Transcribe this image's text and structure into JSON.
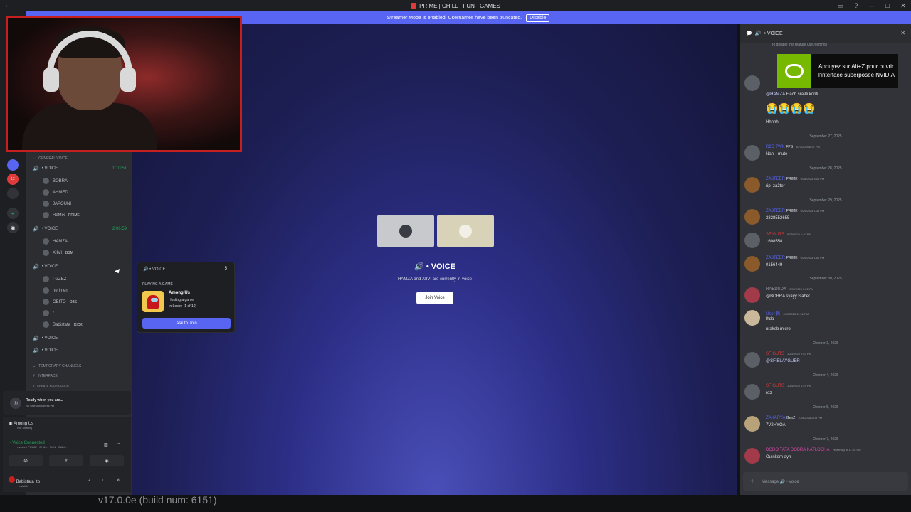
{
  "window": {
    "title": "PRIME | CHILL · FUN · GAMES"
  },
  "banner": {
    "text": "Streamer Mode is enabled. Usernames have been truncated.",
    "disable_label": "Disable"
  },
  "guilds": {
    "badge": "12"
  },
  "channels": {
    "category_general": "GENERAL VOICE",
    "voice1": {
      "name": "• VOICE",
      "time": "1:10:51",
      "members": [
        "BOBRA",
        "AHMED",
        "JAPOUNI",
        "ReMix"
      ],
      "tag": "PRIME"
    },
    "voice2": {
      "name": "• VOICE",
      "time": "2:06:59",
      "members": [
        "HAMZA",
        "XIIVI"
      ],
      "tag": "BSM"
    },
    "voice3": {
      "name": "• VOICE",
      "members": [
        "! GZEZ",
        "nerimen",
        "OBITO",
        "r...",
        "Babistata"
      ],
      "tags": [
        "OBS",
        "KICK"
      ]
    },
    "voice4": {
      "name": "• VOICE"
    },
    "voice5": {
      "name": "• VOICE"
    },
    "category_temp": "TEMPORARY CHANNELS",
    "interface": "INTERFACE",
    "create": "CREATE YOUR COUCH"
  },
  "quest": {
    "title": "Ready when you are...",
    "subtitle": "No Quest progress yet"
  },
  "activity": {
    "game": "Among Us",
    "status": "Not Sharing"
  },
  "connection": {
    "status": "Voice Connected",
    "channel": "• voice / PRIME | CHILL · FUN · GAM..."
  },
  "user": {
    "name": "Babistata_to",
    "status": "Invisible"
  },
  "stage": {
    "title": "• VOICE",
    "subtitle": "HAMZA and XIIVI are currently in voice",
    "join_label": "Join Voice"
  },
  "popout": {
    "header": "• VOICE",
    "count": "5",
    "label": "PLAYING A GAME",
    "game": "Among Us",
    "line1": "Hosting a game",
    "line2": "In Lobby (1 of 10)",
    "ask_label": "Ask to Join"
  },
  "chat": {
    "header": "• VOICE",
    "notice": "To disable this feature use /settings",
    "messages": [
      {
        "name": "@HAMZA",
        "text": "Flach sra9li konti",
        "color": "#c9cdfb"
      },
      {
        "name": "",
        "text": "😭😭😭😭",
        "color": "#dbdee1"
      },
      {
        "name": "",
        "text": "Hhhhh",
        "color": "#dbdee1"
      }
    ],
    "dates": [
      "September 27, 2025",
      "September 28, 2025",
      "September 29, 2025",
      "September 30, 2025",
      "October 3, 2025",
      "October 4, 2025",
      "October 5, 2025",
      "October 7, 2025"
    ],
    "entries": [
      {
        "name": "R2D 7WK",
        "tag": "FPS",
        "time": "9/27/2025 6:37 PM",
        "text": "Nahi l mute",
        "color": "#5865f2"
      },
      {
        "name": "ZA3TEER",
        "tag": "PRIME",
        "time": "9/28/2025 4:01 PM",
        "text": "rip_za3ter",
        "color": "#5865f2"
      },
      {
        "name": "ZA3TEER",
        "tag": "PRIME",
        "time": "9/29/2025 1:39 PM",
        "text": "2828552655",
        "color": "#5865f2"
      },
      {
        "name": "SF GUTS",
        "tag": "",
        "time": "9/29/2025 1:40 PM",
        "text": "1608558",
        "color": "#e03a3a"
      },
      {
        "name": "ZA3TEER",
        "tag": "PRIME",
        "time": "9/29/2025 1:50 PM",
        "text": "0156449",
        "color": "#5865f2"
      },
      {
        "name": "RAEDSDX",
        "tag": "",
        "time": "9/30/2025 6:22 PM",
        "text": "@BOBRA syayy tsabet",
        "color": "#949ba4"
      },
      {
        "name": "User 民",
        "tag": "",
        "time": "9/30/2025 11:51 PM",
        "text": "lhda",
        "color": "#5865f2"
      },
      {
        "name": "",
        "tag": "",
        "time": "",
        "text": "nrakeb micro",
        "color": "#dbdee1"
      },
      {
        "name": "SF GUTS",
        "tag": "",
        "time": "10/3/2025 2:53 PM",
        "text": "@SF BLAYGUER",
        "color": "#e03a3a"
      },
      {
        "name": "SF GUTS",
        "tag": "",
        "time": "10/4/2025 1:29 PM",
        "text": "roz",
        "color": "#e03a3a"
      },
      {
        "name": "ZAKARYA",
        "tag": "GenZ",
        "time": "10/5/2025 2:08 PM",
        "text": "7V2HYOA",
        "color": "#5865f2"
      },
      {
        "name": "DODO TATA DOBRA KATLOCHA",
        "tag": "",
        "time": "Yesterday at 11:05 PM",
        "text": "Ouinkom ayh",
        "color": "#d946a8"
      }
    ],
    "input_placeholder": "Message 🔊 • voice"
  },
  "nvidia": {
    "text": "Appuyez sur Alt+Z pour ouvrir l'interface superposée NVIDIA"
  },
  "footer": {
    "version": "v17.0.0e (build num: 6151)"
  }
}
